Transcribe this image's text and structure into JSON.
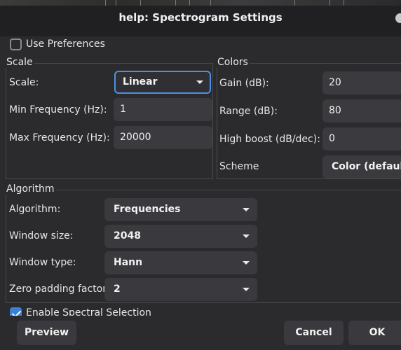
{
  "window": {
    "title": "help: Spectrogram Settings"
  },
  "prefs": {
    "use_preferences_label": "Use Preferences",
    "use_preferences_checked": false
  },
  "scale": {
    "group_title": "Scale",
    "scale_label": "Scale:",
    "scale_value": "Linear",
    "min_freq_label": "Min Frequency (Hz):",
    "min_freq_value": "1",
    "max_freq_label": "Max Frequency (Hz):",
    "max_freq_value": "20000"
  },
  "colors": {
    "group_title": "Colors",
    "gain_label": "Gain (dB):",
    "gain_value": "20",
    "range_label": "Range (dB):",
    "range_value": "80",
    "boost_label": "High boost (dB/dec):",
    "boost_value": "0",
    "scheme_label": "Scheme",
    "scheme_value": "Color (default)"
  },
  "algorithm": {
    "group_title": "Algorithm",
    "algorithm_label": "Algorithm:",
    "algorithm_value": "Frequencies",
    "window_size_label": "Window size:",
    "window_size_value": "2048",
    "window_type_label": "Window type:",
    "window_type_value": "Hann",
    "zero_pad_label": "Zero padding factor:",
    "zero_pad_value": "2"
  },
  "spectral": {
    "enable_label": "Enable Spectral Selection",
    "enable_checked": true
  },
  "buttons": {
    "preview": "Preview",
    "cancel": "Cancel",
    "ok": "OK"
  }
}
